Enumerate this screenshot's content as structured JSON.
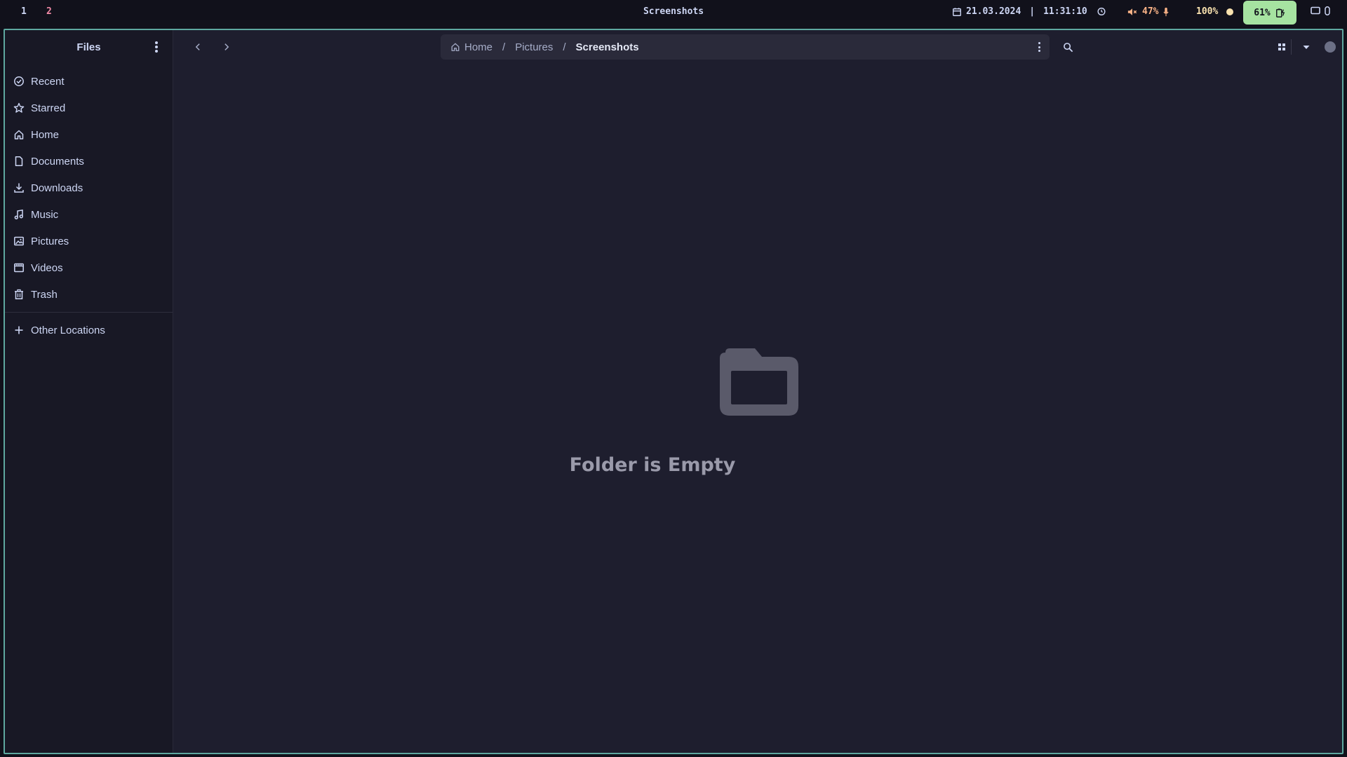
{
  "topbar": {
    "workspaces": [
      "1",
      "2"
    ],
    "window_title": "Screenshots",
    "date": "21.03.2024",
    "time": "11:31:10",
    "volume": "47%",
    "brightness": "100%",
    "battery": "61%"
  },
  "sidebar": {
    "title": "Files",
    "places": [
      {
        "label": "Recent",
        "icon": "clock-icon"
      },
      {
        "label": "Starred",
        "icon": "star-icon"
      },
      {
        "label": "Home",
        "icon": "home-icon"
      },
      {
        "label": "Documents",
        "icon": "document-icon"
      },
      {
        "label": "Downloads",
        "icon": "download-icon"
      },
      {
        "label": "Music",
        "icon": "music-icon"
      },
      {
        "label": "Pictures",
        "icon": "picture-icon"
      },
      {
        "label": "Videos",
        "icon": "video-icon"
      },
      {
        "label": "Trash",
        "icon": "trash-icon"
      }
    ],
    "other": {
      "label": "Other Locations",
      "icon": "plus-icon"
    }
  },
  "path": {
    "crumbs": [
      "Home",
      "Pictures",
      "Screenshots"
    ]
  },
  "content": {
    "empty_message": "Folder is Empty"
  },
  "colors": {
    "accent_border": "#5ea8a0",
    "workspace_active": "#f38ba8",
    "battery_bg": "#a6e3a1",
    "volume": "#fab387",
    "brightness": "#f9e2af"
  }
}
